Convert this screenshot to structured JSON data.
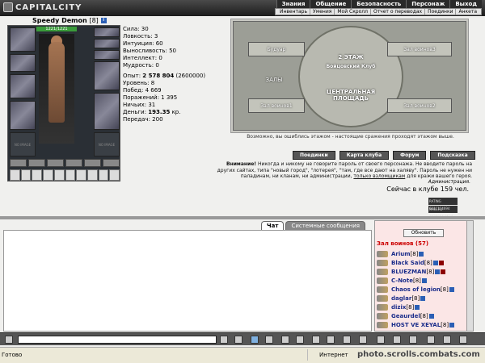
{
  "app": {
    "logo": "CAPITALCITY"
  },
  "top_menu": [
    "Знания",
    "Общение",
    "Безопасность",
    "Персонаж",
    "Выход"
  ],
  "sub_menu": [
    "Инвентарь",
    "Умения",
    "Мой Скролл",
    "Отчет о переводах",
    "Поединки",
    "Анкета"
  ],
  "character": {
    "name": "Speedy Demon",
    "level": "[8]",
    "hp": "1221/1221"
  },
  "stats": [
    "Сила: 30",
    "Ловкость: 3",
    "Интуиция: 60",
    "Выносливость: 50",
    "Интеллект: 0",
    "Мудрость: 0"
  ],
  "stats2": {
    "exp_label": "Опыт: ",
    "exp_value": "2 578 804",
    "exp_next": " (2600000)",
    "rest": [
      "Уровень: 8",
      "Побед: 4 669",
      "Поражений: 1 395",
      "Ничьих: 31"
    ],
    "money_label": "Деньги: ",
    "money_value": "193.35",
    "money_unit": " кр.",
    "transfers": "Передач: 200"
  },
  "empty_slot_label": "NO IMAGE",
  "map": {
    "floor": "2 ЭТАЖ",
    "zone": "Бойцовский Клуб",
    "halls": [
      "Будуар",
      "Зал воинов3",
      "Зал воинов1",
      "Зал воинов2"
    ],
    "label_hall": "ЗАЛЫ",
    "label_square": "ЦЕНТРАЛЬНАЯ ПЛОЩАДЬ",
    "note": "Возможно, вы ошиблись этажом - настоящие сражения проходят этажом выше."
  },
  "buttons": [
    "Поединки",
    "Карта клуба",
    "Форум",
    "Подсказка"
  ],
  "warning": {
    "bold": "Внимание!",
    "text": " Никогда и никому не говорите пароль от своего персонажа. Не вводите пароль на других сайтах, типа \"новый город\", \"лотерея\", \"там, где все дают на халяву\". Пароль не нужен ни паладинам, ни кланам, ни администрации, ",
    "link": "только взломщикам",
    "tail": " для кражи вашего героя."
  },
  "admin": "Администрация.",
  "online": "Сейчас в клубе 159 чел.",
  "counters": [
    "RATING 6211114694",
    "MAIL.RU 1035094 8534"
  ],
  "tabs": {
    "chat": "Чат",
    "system": "Системные сообщения"
  },
  "sidebar": {
    "refresh": "Обновить",
    "room": "Зал воинов (57)",
    "users": [
      {
        "name": "Arium",
        "lvl": "[8]"
      },
      {
        "name": "Black Said",
        "lvl": "[8]"
      },
      {
        "name": "BLUEZMAN",
        "lvl": "[8]"
      },
      {
        "name": "C-Note",
        "lvl": "[8]"
      },
      {
        "name": "Chaos of legion",
        "lvl": "[8]"
      },
      {
        "name": "daglar",
        "lvl": "[8]"
      },
      {
        "name": "dizix",
        "lvl": "[8]"
      },
      {
        "name": "Geaurdel",
        "lvl": "[8]"
      },
      {
        "name": "HOST VE XEYAL",
        "lvl": "[8]"
      }
    ]
  },
  "status": {
    "ready": "Готово",
    "zone": "Интернет",
    "watermark": "photo.scrolls.combats.com"
  }
}
